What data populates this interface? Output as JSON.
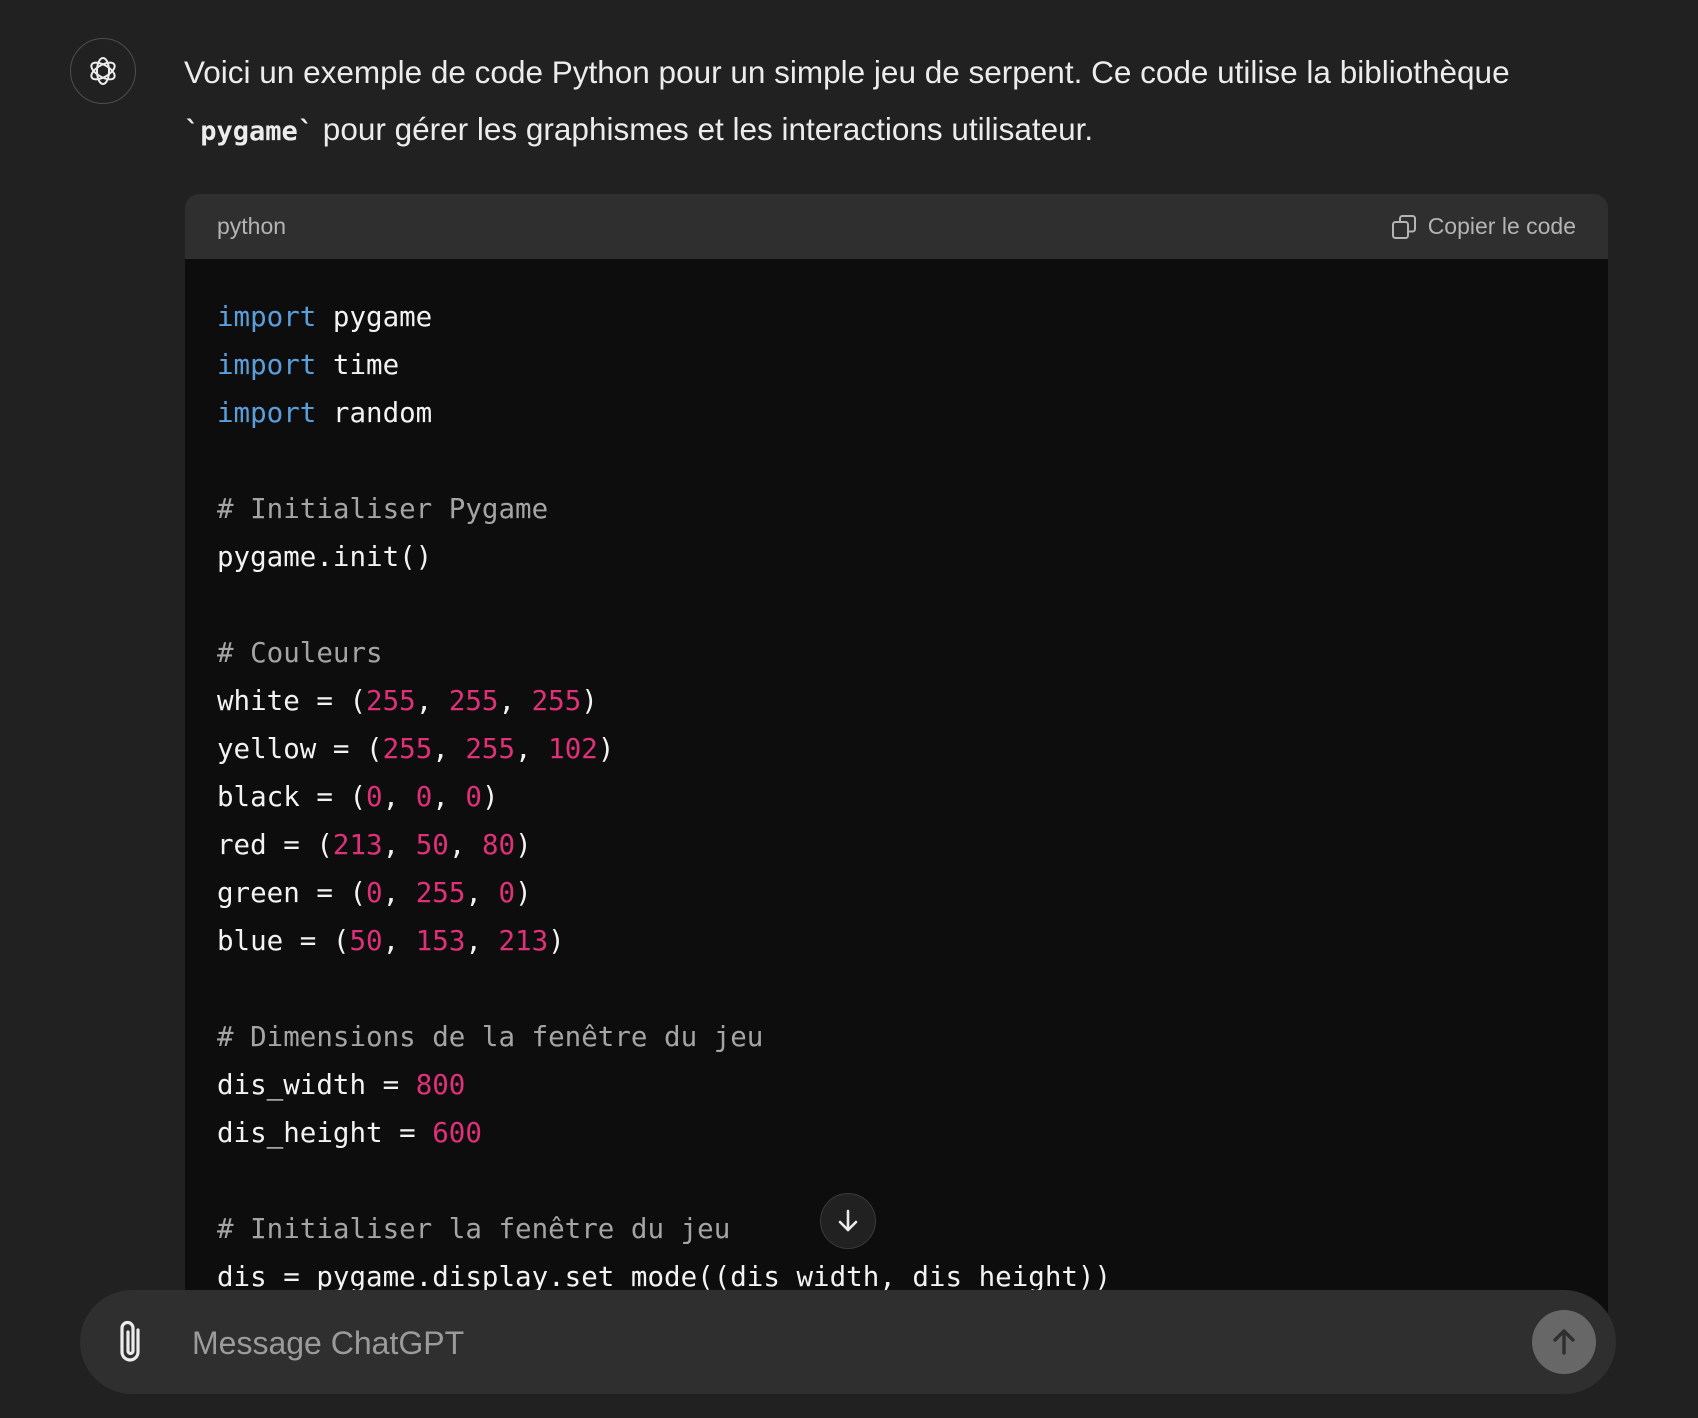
{
  "message": {
    "intro_part1": "Voici un exemple de code Python pour un simple jeu de serpent. Ce code utilise la bibliothèque ",
    "inline_code": "`pygame`",
    "intro_part2": " pour gérer les graphismes et les interactions utilisateur."
  },
  "code_block": {
    "language": "python",
    "copy_label": "Copier le code",
    "lines": [
      [
        {
          "t": "import",
          "c": "kw"
        },
        {
          "t": " pygame",
          "c": ""
        }
      ],
      [
        {
          "t": "import",
          "c": "kw"
        },
        {
          "t": " time",
          "c": ""
        }
      ],
      [
        {
          "t": "import",
          "c": "kw"
        },
        {
          "t": " random",
          "c": ""
        }
      ],
      [],
      [
        {
          "t": "# Initialiser Pygame",
          "c": "cm"
        }
      ],
      [
        {
          "t": "pygame.init()",
          "c": ""
        }
      ],
      [],
      [
        {
          "t": "# Couleurs",
          "c": "cm"
        }
      ],
      [
        {
          "t": "white = (",
          "c": ""
        },
        {
          "t": "255",
          "c": "num"
        },
        {
          "t": ", ",
          "c": ""
        },
        {
          "t": "255",
          "c": "num"
        },
        {
          "t": ", ",
          "c": ""
        },
        {
          "t": "255",
          "c": "num"
        },
        {
          "t": ")",
          "c": ""
        }
      ],
      [
        {
          "t": "yellow = (",
          "c": ""
        },
        {
          "t": "255",
          "c": "num"
        },
        {
          "t": ", ",
          "c": ""
        },
        {
          "t": "255",
          "c": "num"
        },
        {
          "t": ", ",
          "c": ""
        },
        {
          "t": "102",
          "c": "num"
        },
        {
          "t": ")",
          "c": ""
        }
      ],
      [
        {
          "t": "black = (",
          "c": ""
        },
        {
          "t": "0",
          "c": "num"
        },
        {
          "t": ", ",
          "c": ""
        },
        {
          "t": "0",
          "c": "num"
        },
        {
          "t": ", ",
          "c": ""
        },
        {
          "t": "0",
          "c": "num"
        },
        {
          "t": ")",
          "c": ""
        }
      ],
      [
        {
          "t": "red = (",
          "c": ""
        },
        {
          "t": "213",
          "c": "num"
        },
        {
          "t": ", ",
          "c": ""
        },
        {
          "t": "50",
          "c": "num"
        },
        {
          "t": ", ",
          "c": ""
        },
        {
          "t": "80",
          "c": "num"
        },
        {
          "t": ")",
          "c": ""
        }
      ],
      [
        {
          "t": "green = (",
          "c": ""
        },
        {
          "t": "0",
          "c": "num"
        },
        {
          "t": ", ",
          "c": ""
        },
        {
          "t": "255",
          "c": "num"
        },
        {
          "t": ", ",
          "c": ""
        },
        {
          "t": "0",
          "c": "num"
        },
        {
          "t": ")",
          "c": ""
        }
      ],
      [
        {
          "t": "blue = (",
          "c": ""
        },
        {
          "t": "50",
          "c": "num"
        },
        {
          "t": ", ",
          "c": ""
        },
        {
          "t": "153",
          "c": "num"
        },
        {
          "t": ", ",
          "c": ""
        },
        {
          "t": "213",
          "c": "num"
        },
        {
          "t": ")",
          "c": ""
        }
      ],
      [],
      [
        {
          "t": "# Dimensions de la fenêtre du jeu",
          "c": "cm"
        }
      ],
      [
        {
          "t": "dis_width = ",
          "c": ""
        },
        {
          "t": "800",
          "c": "num"
        }
      ],
      [
        {
          "t": "dis_height = ",
          "c": ""
        },
        {
          "t": "600",
          "c": "num"
        }
      ],
      [],
      [
        {
          "t": "# Initialiser la fenêtre du jeu",
          "c": "cm"
        }
      ],
      [
        {
          "t": "dis = pygame.display.set_mode((dis_width, dis_height))",
          "c": ""
        }
      ]
    ]
  },
  "composer": {
    "placeholder": "Message ChatGPT"
  },
  "icons": {
    "avatar": "openai-logo-icon",
    "copy": "copy-icon",
    "scroll": "arrow-down-icon",
    "attach": "paperclip-icon",
    "send": "arrow-up-icon"
  },
  "colors": {
    "background": "#212121",
    "code_background": "#0d0d0d",
    "code_header": "#2f2f2f",
    "keyword": "#5a9fdc",
    "number": "#df3079",
    "comment": "#a4a4a4"
  }
}
